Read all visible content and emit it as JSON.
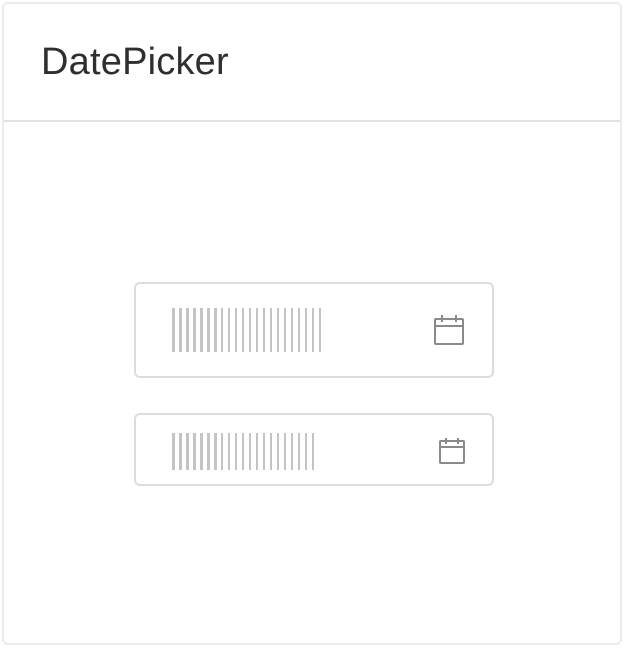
{
  "card": {
    "title": "DatePicker"
  },
  "datepickers": [
    {
      "size": "large",
      "value": "",
      "icon": "calendar-icon"
    },
    {
      "size": "small",
      "value": "",
      "icon": "calendar-icon"
    }
  ],
  "colors": {
    "border": "#dcdcdc",
    "divider": "#e2e2e2",
    "placeholder": "#c4c4c4",
    "icon": "#8a8a8a",
    "title": "#2f2f2f"
  }
}
